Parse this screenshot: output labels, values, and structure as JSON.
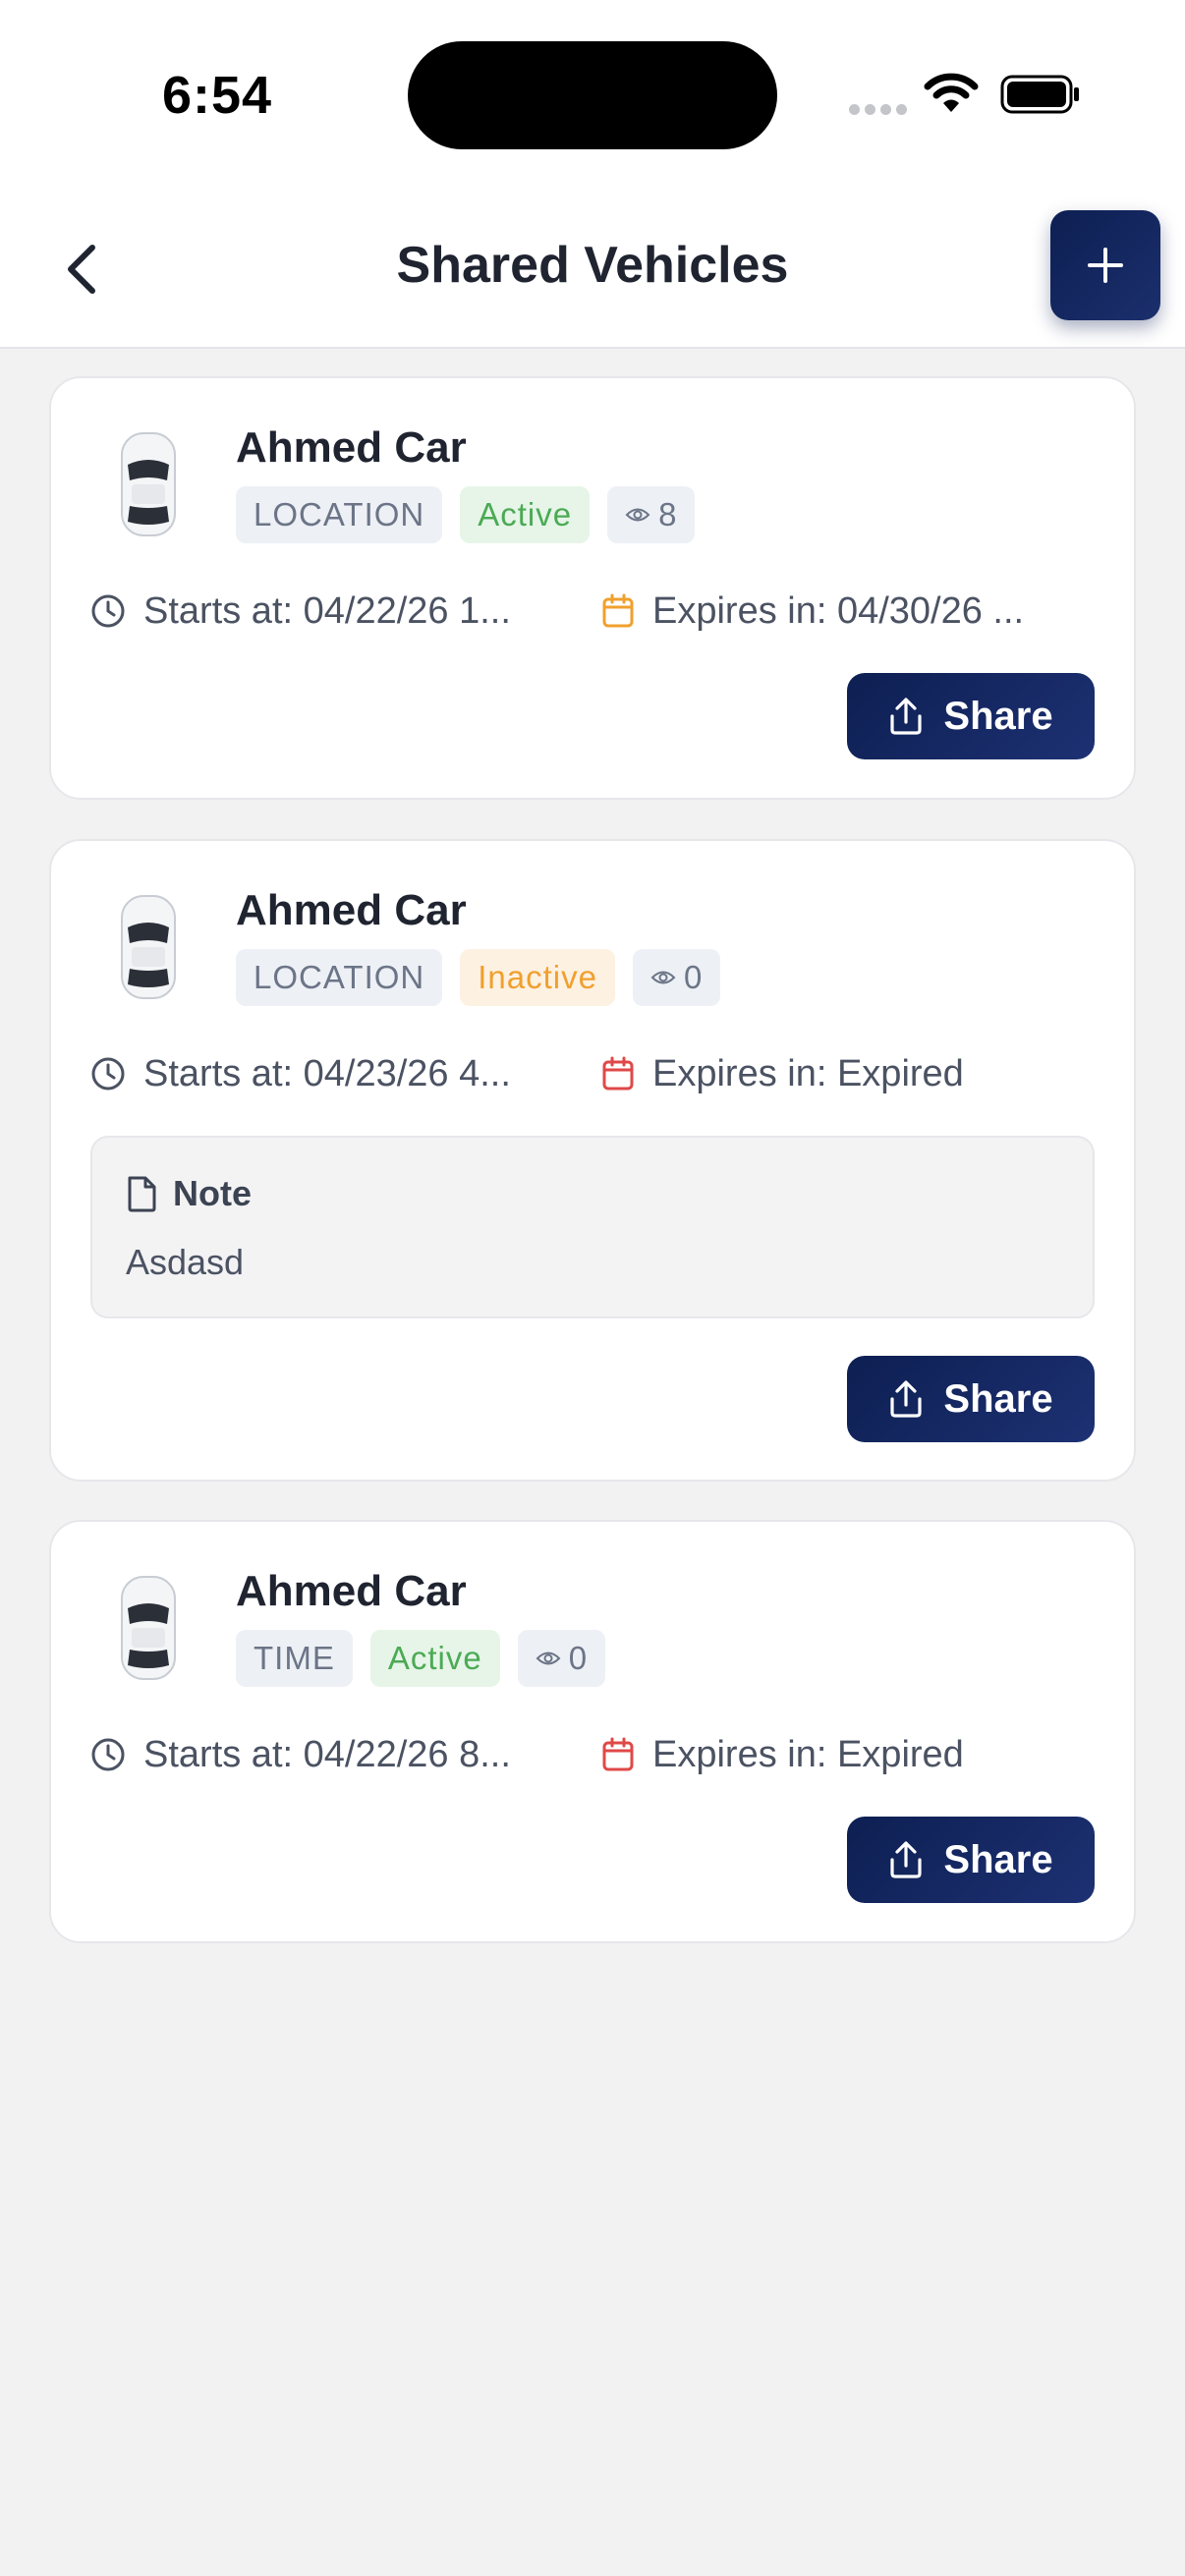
{
  "status_bar": {
    "time": "6:54"
  },
  "header": {
    "title": "Shared Vehicles"
  },
  "cards": [
    {
      "name": "Ahmed Car",
      "type": "LOCATION",
      "status": "Active",
      "views": "8",
      "starts": "Starts at: 04/22/26 1...",
      "expires": "Expires in: 04/30/26 ...",
      "share_label": "Share"
    },
    {
      "name": "Ahmed Car",
      "type": "LOCATION",
      "status": "Inactive",
      "views": "0",
      "starts": "Starts at: 04/23/26 4...",
      "expires": "Expires in: Expired",
      "note_title": "Note",
      "note_text": "Asdasd",
      "share_label": "Share"
    },
    {
      "name": "Ahmed Car",
      "type": "TIME",
      "status": "Active",
      "views": "0",
      "starts": "Starts at: 04/22/26 8...",
      "expires": "Expires in: Expired",
      "share_label": "Share"
    }
  ],
  "colors": {
    "primary": "#0d1f52",
    "active": "#4caa55",
    "inactive": "#f0a02e",
    "expires_future": "#f0a02e",
    "expires_expired": "#e04848"
  }
}
